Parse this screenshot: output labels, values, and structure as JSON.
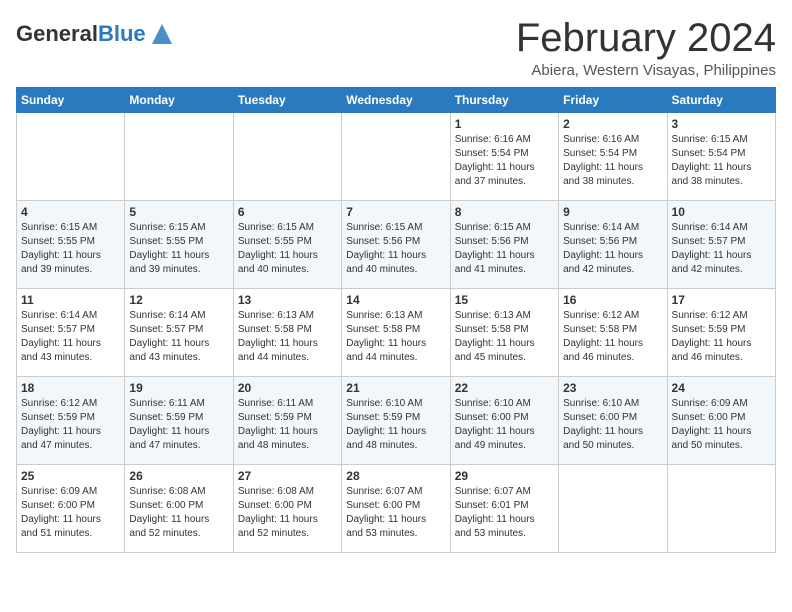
{
  "header": {
    "logo_general": "General",
    "logo_blue": "Blue",
    "month_title": "February 2024",
    "location": "Abiera, Western Visayas, Philippines"
  },
  "days_of_week": [
    "Sunday",
    "Monday",
    "Tuesday",
    "Wednesday",
    "Thursday",
    "Friday",
    "Saturday"
  ],
  "weeks": [
    [
      {
        "day": "",
        "detail": ""
      },
      {
        "day": "",
        "detail": ""
      },
      {
        "day": "",
        "detail": ""
      },
      {
        "day": "",
        "detail": ""
      },
      {
        "day": "1",
        "detail": "Sunrise: 6:16 AM\nSunset: 5:54 PM\nDaylight: 11 hours\nand 37 minutes."
      },
      {
        "day": "2",
        "detail": "Sunrise: 6:16 AM\nSunset: 5:54 PM\nDaylight: 11 hours\nand 38 minutes."
      },
      {
        "day": "3",
        "detail": "Sunrise: 6:15 AM\nSunset: 5:54 PM\nDaylight: 11 hours\nand 38 minutes."
      }
    ],
    [
      {
        "day": "4",
        "detail": "Sunrise: 6:15 AM\nSunset: 5:55 PM\nDaylight: 11 hours\nand 39 minutes."
      },
      {
        "day": "5",
        "detail": "Sunrise: 6:15 AM\nSunset: 5:55 PM\nDaylight: 11 hours\nand 39 minutes."
      },
      {
        "day": "6",
        "detail": "Sunrise: 6:15 AM\nSunset: 5:55 PM\nDaylight: 11 hours\nand 40 minutes."
      },
      {
        "day": "7",
        "detail": "Sunrise: 6:15 AM\nSunset: 5:56 PM\nDaylight: 11 hours\nand 40 minutes."
      },
      {
        "day": "8",
        "detail": "Sunrise: 6:15 AM\nSunset: 5:56 PM\nDaylight: 11 hours\nand 41 minutes."
      },
      {
        "day": "9",
        "detail": "Sunrise: 6:14 AM\nSunset: 5:56 PM\nDaylight: 11 hours\nand 42 minutes."
      },
      {
        "day": "10",
        "detail": "Sunrise: 6:14 AM\nSunset: 5:57 PM\nDaylight: 11 hours\nand 42 minutes."
      }
    ],
    [
      {
        "day": "11",
        "detail": "Sunrise: 6:14 AM\nSunset: 5:57 PM\nDaylight: 11 hours\nand 43 minutes."
      },
      {
        "day": "12",
        "detail": "Sunrise: 6:14 AM\nSunset: 5:57 PM\nDaylight: 11 hours\nand 43 minutes."
      },
      {
        "day": "13",
        "detail": "Sunrise: 6:13 AM\nSunset: 5:58 PM\nDaylight: 11 hours\nand 44 minutes."
      },
      {
        "day": "14",
        "detail": "Sunrise: 6:13 AM\nSunset: 5:58 PM\nDaylight: 11 hours\nand 44 minutes."
      },
      {
        "day": "15",
        "detail": "Sunrise: 6:13 AM\nSunset: 5:58 PM\nDaylight: 11 hours\nand 45 minutes."
      },
      {
        "day": "16",
        "detail": "Sunrise: 6:12 AM\nSunset: 5:58 PM\nDaylight: 11 hours\nand 46 minutes."
      },
      {
        "day": "17",
        "detail": "Sunrise: 6:12 AM\nSunset: 5:59 PM\nDaylight: 11 hours\nand 46 minutes."
      }
    ],
    [
      {
        "day": "18",
        "detail": "Sunrise: 6:12 AM\nSunset: 5:59 PM\nDaylight: 11 hours\nand 47 minutes."
      },
      {
        "day": "19",
        "detail": "Sunrise: 6:11 AM\nSunset: 5:59 PM\nDaylight: 11 hours\nand 47 minutes."
      },
      {
        "day": "20",
        "detail": "Sunrise: 6:11 AM\nSunset: 5:59 PM\nDaylight: 11 hours\nand 48 minutes."
      },
      {
        "day": "21",
        "detail": "Sunrise: 6:10 AM\nSunset: 5:59 PM\nDaylight: 11 hours\nand 48 minutes."
      },
      {
        "day": "22",
        "detail": "Sunrise: 6:10 AM\nSunset: 6:00 PM\nDaylight: 11 hours\nand 49 minutes."
      },
      {
        "day": "23",
        "detail": "Sunrise: 6:10 AM\nSunset: 6:00 PM\nDaylight: 11 hours\nand 50 minutes."
      },
      {
        "day": "24",
        "detail": "Sunrise: 6:09 AM\nSunset: 6:00 PM\nDaylight: 11 hours\nand 50 minutes."
      }
    ],
    [
      {
        "day": "25",
        "detail": "Sunrise: 6:09 AM\nSunset: 6:00 PM\nDaylight: 11 hours\nand 51 minutes."
      },
      {
        "day": "26",
        "detail": "Sunrise: 6:08 AM\nSunset: 6:00 PM\nDaylight: 11 hours\nand 52 minutes."
      },
      {
        "day": "27",
        "detail": "Sunrise: 6:08 AM\nSunset: 6:00 PM\nDaylight: 11 hours\nand 52 minutes."
      },
      {
        "day": "28",
        "detail": "Sunrise: 6:07 AM\nSunset: 6:00 PM\nDaylight: 11 hours\nand 53 minutes."
      },
      {
        "day": "29",
        "detail": "Sunrise: 6:07 AM\nSunset: 6:01 PM\nDaylight: 11 hours\nand 53 minutes."
      },
      {
        "day": "",
        "detail": ""
      },
      {
        "day": "",
        "detail": ""
      }
    ]
  ]
}
